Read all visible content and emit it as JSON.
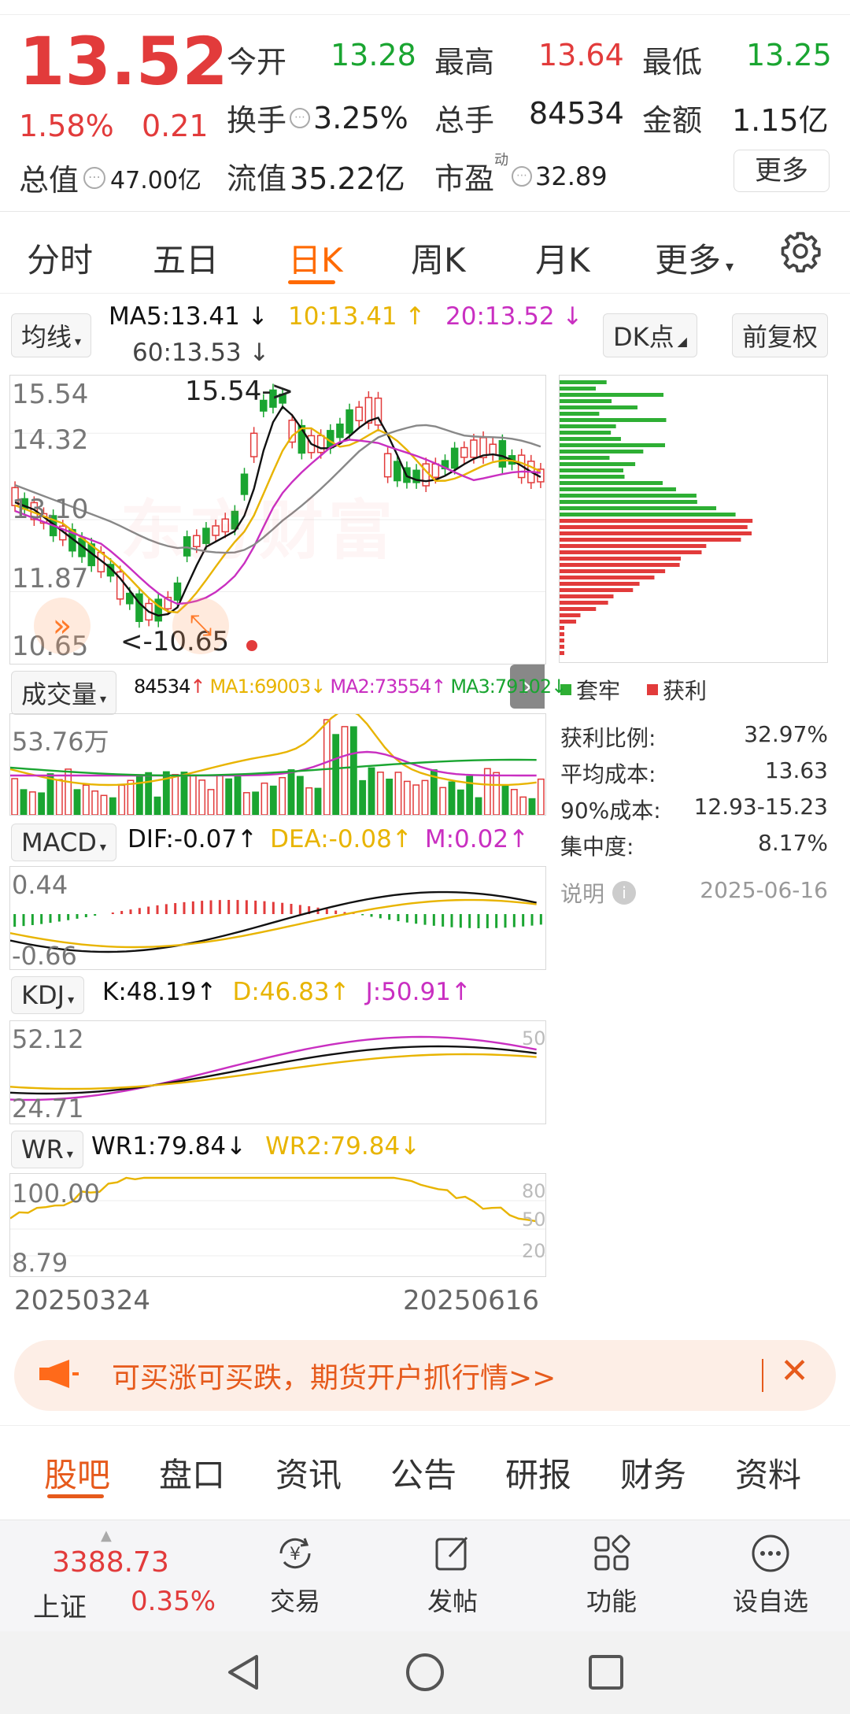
{
  "quote": {
    "price": "13.52",
    "change_pct": "1.58%",
    "change_amt": "0.21",
    "market_cap_label": "总值",
    "market_cap": "47.00亿",
    "stats": [
      {
        "label": "今开",
        "value": "13.28",
        "color": "#1aa531"
      },
      {
        "label": "最高",
        "value": "13.64",
        "color": "#e23b3b"
      },
      {
        "label": "最低",
        "value": "13.25",
        "color": "#1aa531"
      },
      {
        "label": "换手",
        "value": "3.25%",
        "color": "#222222"
      },
      {
        "label": "总手",
        "value": "84534",
        "color": "#222222"
      },
      {
        "label": "金额",
        "value": "1.15亿",
        "color": "#222222"
      },
      {
        "label": "流值",
        "value": "35.22亿",
        "color": "#222222"
      },
      {
        "label": "市盈",
        "value": "32.89",
        "color": "#222222"
      }
    ],
    "pe_superscript": "动",
    "more_button": "更多"
  },
  "period_tabs": [
    "分时",
    "五日",
    "日K",
    "周K",
    "月K",
    "更多"
  ],
  "active_tab": "日K",
  "ma": {
    "selector": "均线",
    "ma5": "MA5:13.41",
    "ma10": "10:13.41",
    "ma20": "20:13.52",
    "ma60": "60:13.53",
    "dk_button": "DK点",
    "restore_button": "前复权"
  },
  "kline": {
    "y_labels": [
      "15.54",
      "14.32",
      "13.10",
      "11.87",
      "10.65"
    ],
    "high_marker": "15.54->",
    "low_marker": "<-10.65",
    "watermark": "东方财富"
  },
  "volume": {
    "selector": "成交量",
    "current": "84534",
    "ma1": "MA1:69003",
    "ma2": "MA2:73554",
    "ma3": "MA3:79102",
    "y_label": "53.76万"
  },
  "macd": {
    "selector": "MACD",
    "dif": "DIF:-0.07",
    "dea": "DEA:-0.08",
    "m": "M:0.02",
    "y_top": "0.44",
    "y_bottom": "-0.66"
  },
  "kdj": {
    "selector": "KDJ",
    "k": "K:48.19",
    "d": "D:46.83",
    "j": "J:50.91",
    "y_top": "52.12",
    "y_bottom": "24.71",
    "right_label": "50"
  },
  "wr": {
    "selector": "WR",
    "wr1": "WR1:79.84",
    "wr2": "WR2:79.84",
    "y_top": "100.00",
    "y_bottom": "8.79",
    "right_labels": [
      "80",
      "50",
      "20"
    ]
  },
  "dates": {
    "start": "20250324",
    "end": "20250616"
  },
  "chip_dist": {
    "legend_trapped": "套牢",
    "legend_profit": "获利",
    "stats": [
      {
        "label": "获利比例:",
        "value": "32.97%"
      },
      {
        "label": "平均成本:",
        "value": "13.63"
      },
      {
        "label": "90%成本:",
        "value": "12.93-15.23"
      },
      {
        "label": "集中度:",
        "value": "8.17%"
      }
    ],
    "note_label": "说明",
    "note_date": "2025-06-16"
  },
  "banner": {
    "text": "可买涨可买跌，期货开户抓行情>>"
  },
  "bottom_tabs": [
    "股吧",
    "盘口",
    "资讯",
    "公告",
    "研报",
    "财务",
    "资料"
  ],
  "active_bottom_tab": "股吧",
  "index": {
    "value": "3388.73",
    "name": "上证",
    "change": "0.35%"
  },
  "nav": [
    {
      "label": "交易",
      "icon": "yuan-cycle-icon"
    },
    {
      "label": "发帖",
      "icon": "edit-icon"
    },
    {
      "label": "功能",
      "icon": "grid-icon"
    },
    {
      "label": "设自选",
      "icon": "more-icon"
    }
  ]
}
